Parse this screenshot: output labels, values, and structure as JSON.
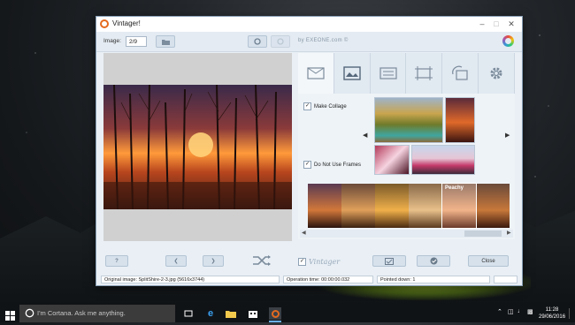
{
  "window": {
    "title": "Vintager!"
  },
  "toolbar": {
    "image_label": "Image:",
    "image_value": "2/9",
    "credit": "by EXEONE.com ©"
  },
  "options": {
    "make_collage": "Make Collage",
    "do_not_use_frames": "Do Not Use Frames"
  },
  "strip": {
    "highlight_label": "Peachy"
  },
  "bottom": {
    "brand": "Vintager",
    "close_label": "Close"
  },
  "status": {
    "original_image": "Original image: SplitShire-2-3.jpg (5616x3744)",
    "operation_time": "Operation time: 00:00:00.032",
    "pointed_down": "Pointed down: 1"
  },
  "taskbar": {
    "search_placeholder": "I'm Cortana. Ask me anything.",
    "time": "11:28",
    "date": "29/06/2016"
  },
  "colors": {
    "accent": "#e46a1f",
    "window_bg": "#e9eff5",
    "taskbar": "#101316"
  }
}
